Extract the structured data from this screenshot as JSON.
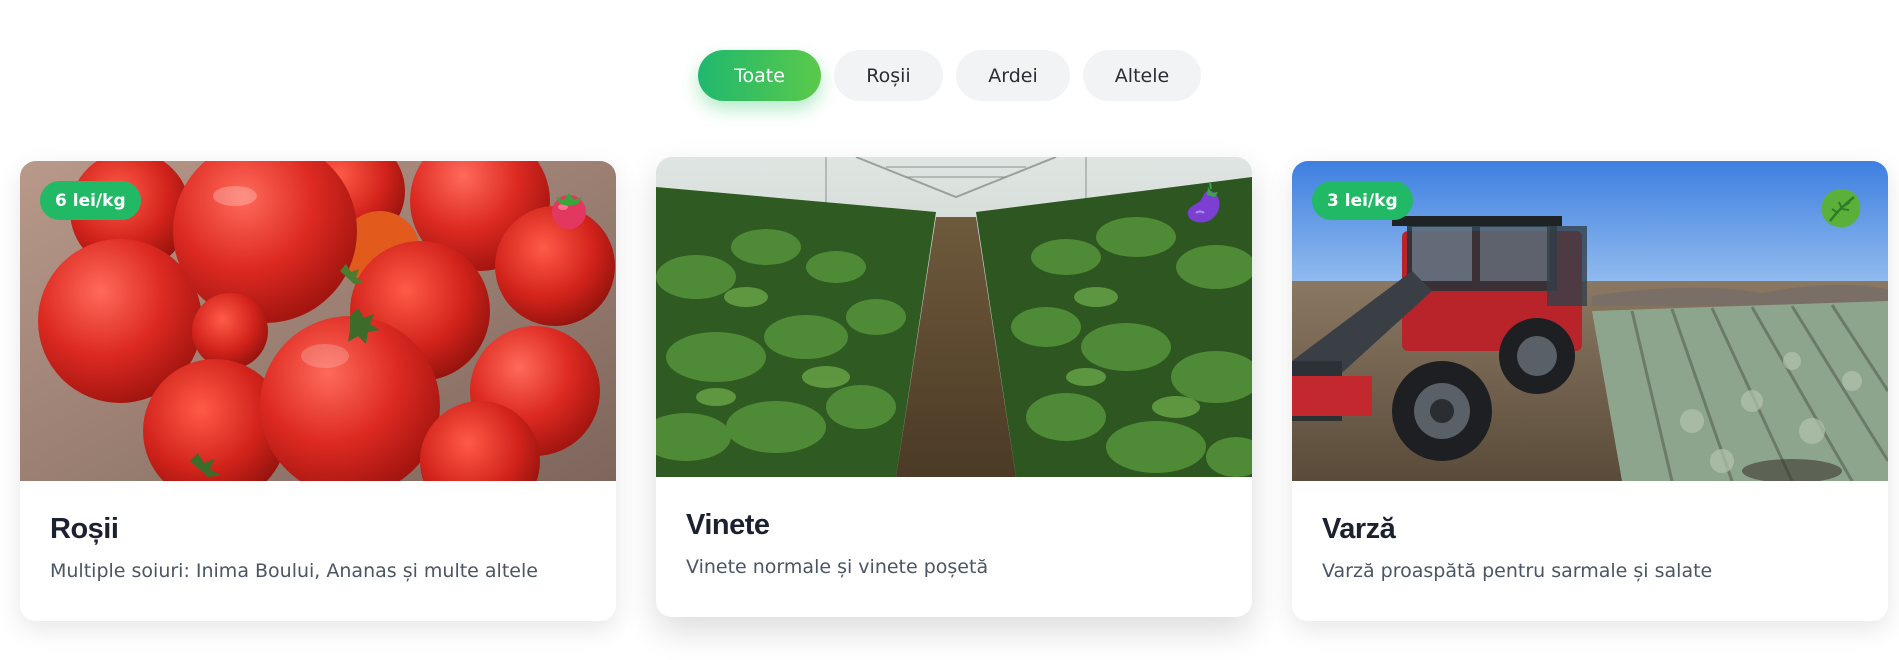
{
  "filters": [
    {
      "label": "Toate",
      "active": true
    },
    {
      "label": "Roșii",
      "active": false
    },
    {
      "label": "Ardei",
      "active": false
    },
    {
      "label": "Altele",
      "active": false
    }
  ],
  "products": [
    {
      "price": "6 lei/kg",
      "icon": "tomato-icon",
      "image": "tomatoes-photo",
      "title": "Roșii",
      "description": "Multiple soiuri: Inima Boului, Ananas și multe altele"
    },
    {
      "price": "",
      "icon": "eggplant-icon",
      "image": "greenhouse-eggplants-photo",
      "title": "Vinete",
      "description": "Vinete normale și vinete poșetă"
    },
    {
      "price": "3 lei/kg",
      "icon": "leafy-green-icon",
      "image": "tractor-cabbage-field-photo",
      "title": "Varză",
      "description": "Varză proaspătă pentru sarmale și salate"
    }
  ],
  "colors": {
    "accent": "#21b866",
    "accent_gradient_end": "#5ac94a",
    "pill_bg": "#f2f3f5",
    "title": "#1c2130",
    "text": "#4b5563"
  }
}
